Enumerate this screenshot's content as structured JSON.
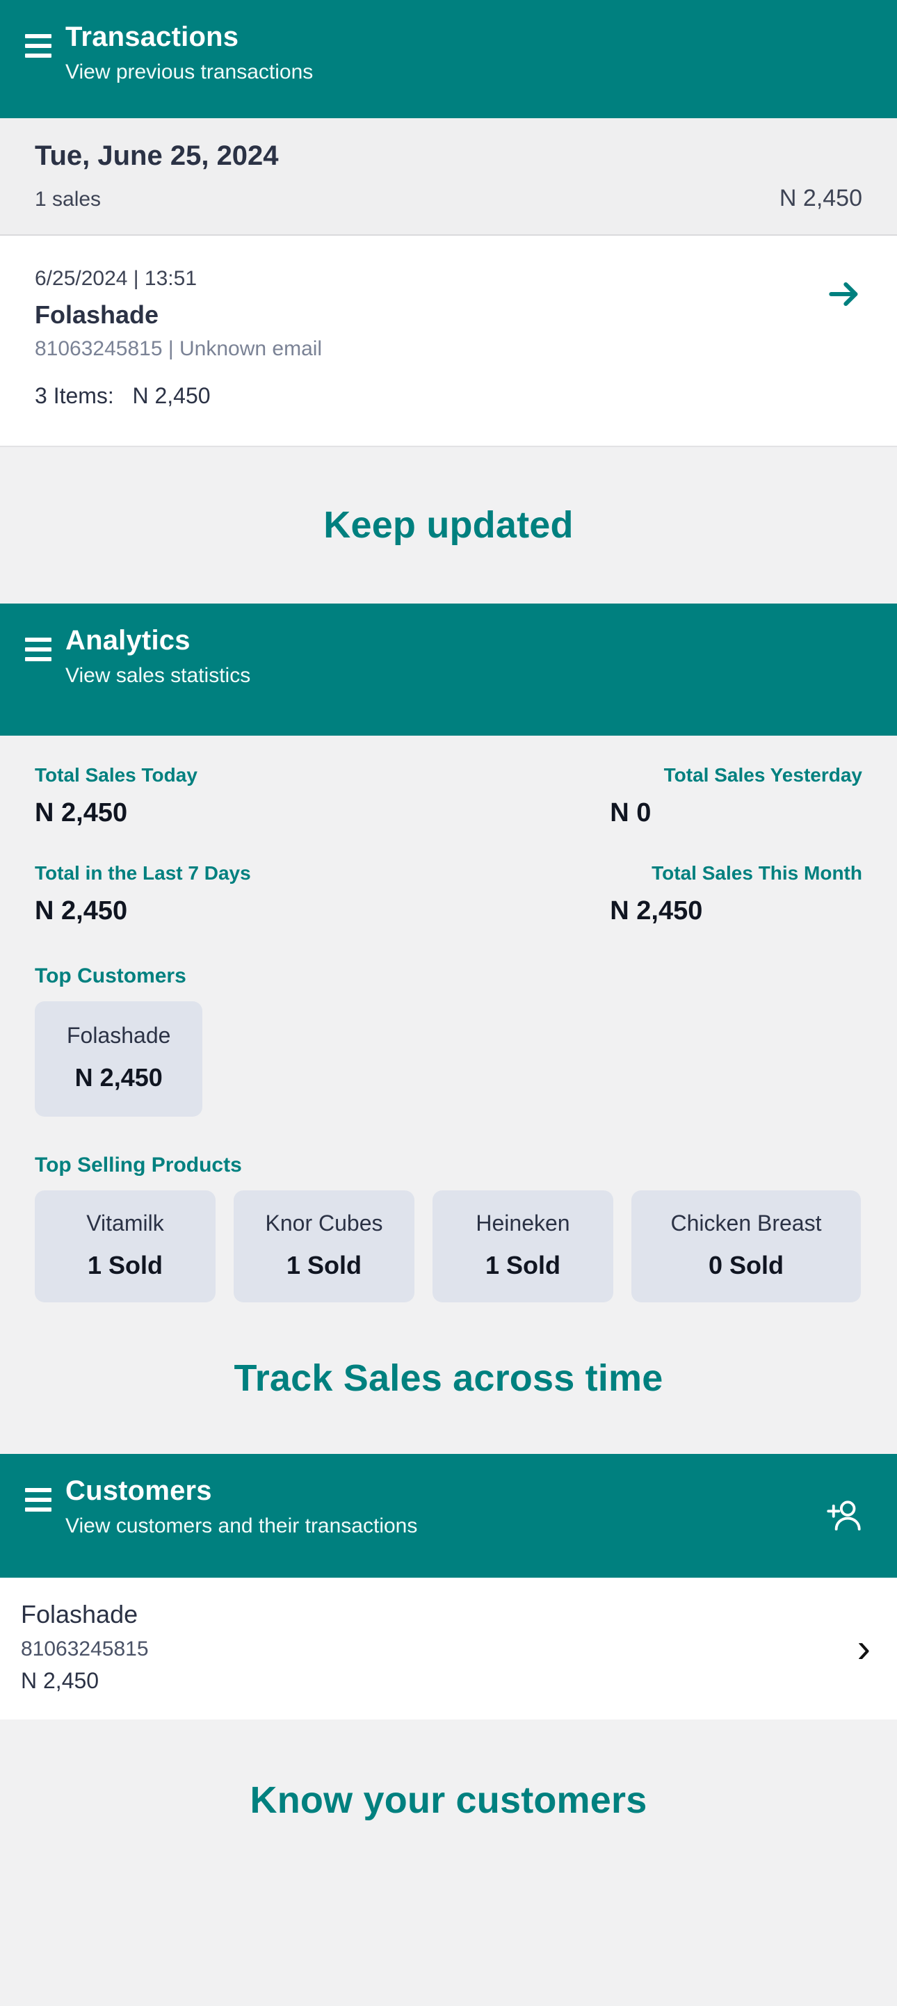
{
  "transactions": {
    "title": "Transactions",
    "subtitle": "View previous transactions",
    "menu_icon": "hamburger-menu-icon",
    "date_group": {
      "date": "Tue, June 25, 2024",
      "sales_count": "1 sales",
      "total": "N 2,450"
    },
    "items": [
      {
        "datetime": "6/25/2024 | 13:51",
        "customer": "Folashade",
        "contact": "81063245815 | Unknown email",
        "items_summary": "3 Items:",
        "amount": "N 2,450",
        "arrow_icon": "arrow-right-icon"
      }
    ]
  },
  "taglines": {
    "keep_updated": "Keep updated",
    "track_sales": "Track Sales across time",
    "know_customers": "Know your customers"
  },
  "analytics": {
    "title": "Analytics",
    "subtitle": "View sales statistics",
    "menu_icon": "hamburger-menu-icon",
    "stats": [
      {
        "label": "Total Sales Today",
        "value": "N 2,450"
      },
      {
        "label": "Total Sales Yesterday",
        "value": "N 0"
      },
      {
        "label": "Total in the Last 7 Days",
        "value": "N 2,450"
      },
      {
        "label": "Total Sales This Month",
        "value": "N 2,450"
      }
    ],
    "top_customers_title": "Top Customers",
    "top_customers": [
      {
        "name": "Folashade",
        "value": "N 2,450"
      }
    ],
    "top_products_title": "Top Selling Products",
    "top_products": [
      {
        "name": "Vitamilk",
        "value": "1 Sold"
      },
      {
        "name": "Knor Cubes",
        "value": "1 Sold"
      },
      {
        "name": "Heineken",
        "value": "1 Sold"
      },
      {
        "name": "Chicken Breast",
        "value": "0 Sold"
      }
    ]
  },
  "customers": {
    "title": "Customers",
    "subtitle": "View customers and their transactions",
    "menu_icon": "hamburger-menu-icon",
    "add_icon": "add-person-icon",
    "list": [
      {
        "name": "Folashade",
        "phone": "81063245815",
        "amount": "N 2,450",
        "chevron_icon": "chevron-right-icon"
      }
    ]
  },
  "colors": {
    "brand_teal": "#00807f",
    "page_bg": "#f1f1f2",
    "card_bg": "#dfe3ec",
    "text_dark": "#2b3245",
    "text_muted": "#7a8295"
  }
}
